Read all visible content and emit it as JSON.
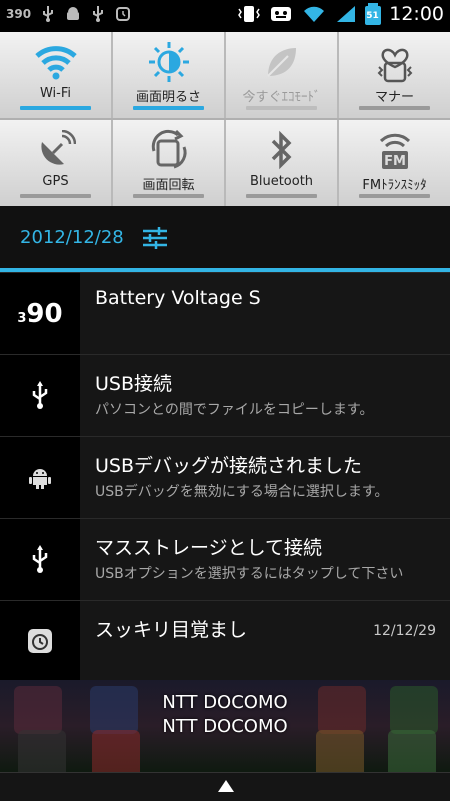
{
  "status_bar": {
    "battery_voltage": "390",
    "clock": "12:00",
    "battery_level": "51"
  },
  "quick_settings": {
    "row1": [
      {
        "label": "Wi-Fi",
        "icon": "wifi-icon",
        "state": "on"
      },
      {
        "label": "画面明るさ",
        "icon": "brightness-icon",
        "state": "on"
      },
      {
        "label": "今すぐｴｺﾓｰﾄﾞ",
        "icon": "eco-leaf-icon",
        "state": "disabled"
      },
      {
        "label": "マナー",
        "icon": "manner-icon",
        "state": "off"
      }
    ],
    "row2": [
      {
        "label": "GPS",
        "icon": "gps-icon",
        "state": "off"
      },
      {
        "label": "画面回転",
        "icon": "rotate-icon",
        "state": "off"
      },
      {
        "label": "Bluetooth",
        "icon": "bluetooth-icon",
        "state": "off"
      },
      {
        "label": "FMﾄﾗﾝｽﾐｯﾀ",
        "icon": "fm-transmitter-icon",
        "state": "off"
      }
    ]
  },
  "date": "2012/12/28",
  "notifications": [
    {
      "title": "Battery Voltage S",
      "subtitle": "",
      "time": "",
      "icon": "battery-voltage-icon",
      "icon_text": "90",
      "icon_small": "3"
    },
    {
      "title": "USB接続",
      "subtitle": "パソコンとの間でファイルをコピーします。",
      "time": "",
      "icon": "usb-icon"
    },
    {
      "title": "USBデバッグが接続されました",
      "subtitle": "USBデバッグを無効にする場合に選択します。",
      "time": "",
      "icon": "android-debug-icon"
    },
    {
      "title": "マスストレージとして接続",
      "subtitle": "USBオプションを選択するにはタップして下さい",
      "time": "",
      "icon": "usb-icon"
    },
    {
      "title": "スッキリ目覚まし",
      "subtitle": "",
      "time": "12/12/29",
      "icon": "alarm-icon"
    }
  ],
  "carrier": {
    "line1": "NTT DOCOMO",
    "line2": "NTT DOCOMO"
  },
  "colors": {
    "accent": "#33b5e5",
    "tile_on_bar": "#2ba8e0"
  }
}
